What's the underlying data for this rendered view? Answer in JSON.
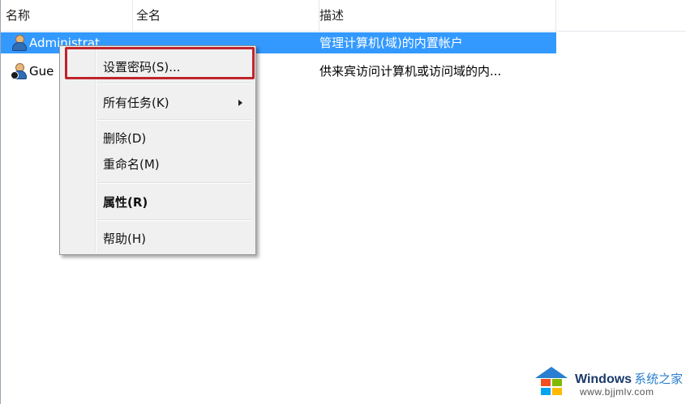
{
  "columns": {
    "name": "名称",
    "full_name": "全名",
    "description": "描述"
  },
  "users": [
    {
      "name": "Administrat",
      "description": "管理计算机(域)的内置帐户",
      "selected": true,
      "icon": "user-icon"
    },
    {
      "name": "Gue",
      "description": "供来宾访问计算机或访问域的内...",
      "selected": false,
      "icon": "guest-user-icon"
    }
  ],
  "context_menu": {
    "set_password": "设置密码(S)...",
    "all_tasks": "所有任务(K)",
    "delete": "删除(D)",
    "rename": "重命名(M)",
    "properties": "属性(R)",
    "help": "帮助(H)"
  },
  "watermark": {
    "brand": "Windows",
    "brand_cn": "系统之家",
    "url": "www.bjjmlv.com"
  },
  "colors": {
    "selection": "#3399ff",
    "highlight_border": "#c0242c",
    "menu_background": "#f0f0f0"
  }
}
